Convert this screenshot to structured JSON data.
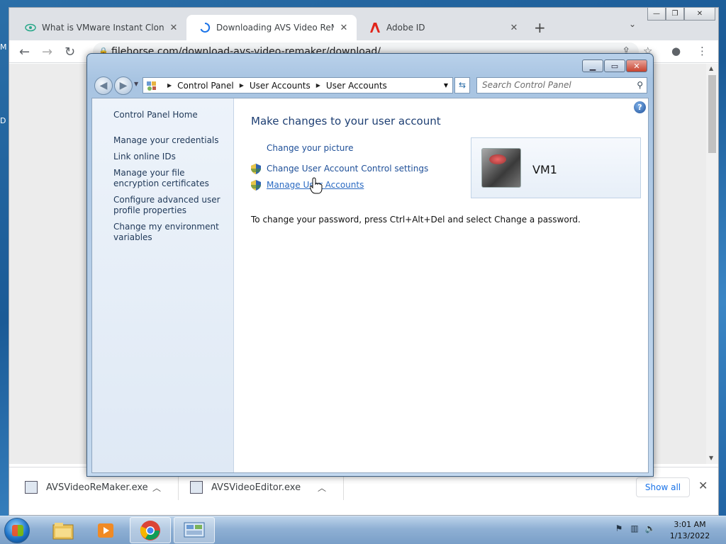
{
  "desktop": {
    "edge_label_1": "M",
    "edge_label_2": "D"
  },
  "browser": {
    "tabs": [
      {
        "title": "What is VMware Instant Clone (V",
        "close": "✕"
      },
      {
        "title": "Downloading AVS Video ReMake",
        "close": "✕"
      },
      {
        "title": "Adobe ID",
        "close": "✕"
      }
    ],
    "new_tab": "+",
    "tab_search": "⌄",
    "url": "filehorse.com/download-avs-video-remaker/download/",
    "window_controls": {
      "minimize": "—",
      "restore": "❐",
      "close": "✕"
    }
  },
  "downloads": {
    "items": [
      {
        "name": "AVSVideoReMaker.exe"
      },
      {
        "name": "AVSVideoEditor.exe"
      }
    ],
    "show_all": "Show all",
    "close": "✕"
  },
  "control_panel": {
    "breadcrumb": [
      "Control Panel",
      "User Accounts",
      "User Accounts"
    ],
    "search_placeholder": "Search Control Panel",
    "sidebar": {
      "home": "Control Panel Home",
      "links": [
        "Manage your credentials",
        "Link online IDs",
        "Manage your file encryption certificates",
        "Configure advanced user profile properties",
        "Change my environment variables"
      ]
    },
    "heading": "Make changes to your user account",
    "tasks": [
      "Change your picture",
      "Change User Account Control settings",
      "Manage User Accounts"
    ],
    "note": "To change your password, press Ctrl+Alt+Del and select Change a password.",
    "user": {
      "name": "VM1"
    },
    "help": "?"
  },
  "taskbar": {
    "clock_time": "3:01 AM",
    "clock_date": "1/13/2022"
  }
}
